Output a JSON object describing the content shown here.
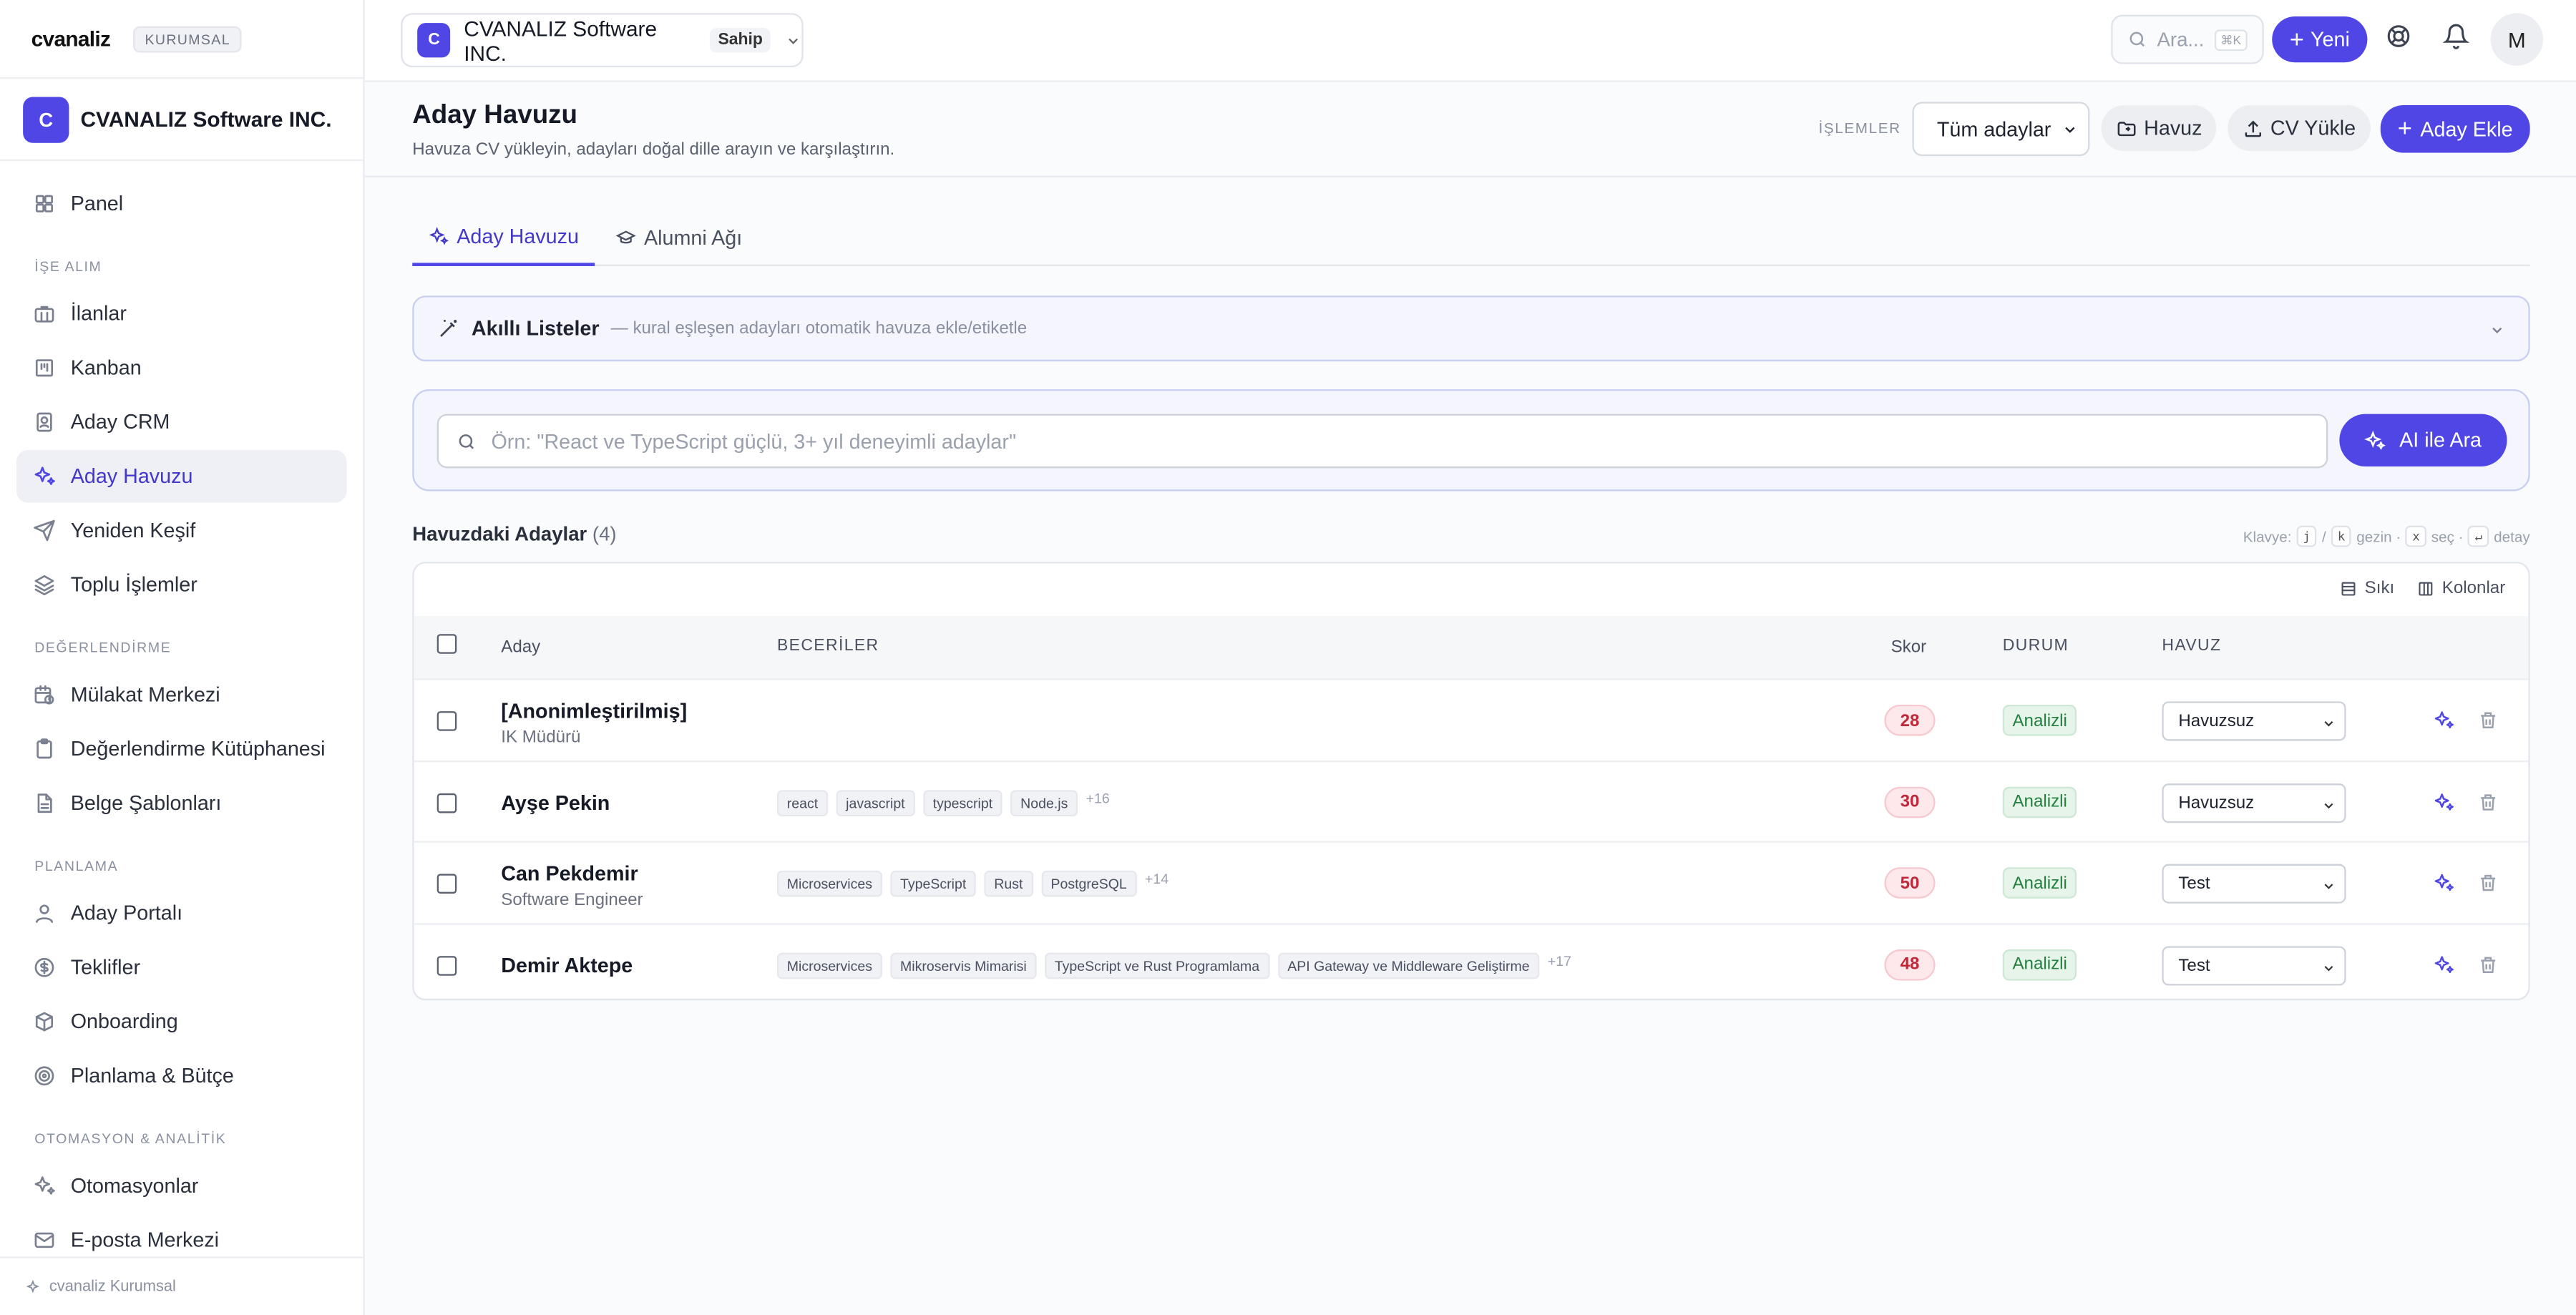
{
  "brand": {
    "logo": "cvanaliz",
    "badge": "KURUMSAL"
  },
  "org": {
    "initial": "C",
    "name": "CVANALIZ Software INC.",
    "role": "Sahip"
  },
  "sidebar": {
    "top": [
      {
        "label": "Panel",
        "icon": "grid-icon"
      }
    ],
    "sections": [
      {
        "title": "İŞE ALIM",
        "items": [
          {
            "label": "İlanlar",
            "icon": "briefcase-icon"
          },
          {
            "label": "Kanban",
            "icon": "kanban-icon"
          },
          {
            "label": "Aday CRM",
            "icon": "contact-card-icon"
          },
          {
            "label": "Aday Havuzu",
            "icon": "sparkles-icon",
            "active": true
          },
          {
            "label": "Yeniden Keşif",
            "icon": "send-icon"
          },
          {
            "label": "Toplu İşlemler",
            "icon": "layers-icon"
          }
        ]
      },
      {
        "title": "DEĞERLENDİRME",
        "items": [
          {
            "label": "Mülakat Merkezi",
            "icon": "calendar-clock-icon"
          },
          {
            "label": "Değerlendirme Kütüphanesi",
            "icon": "clipboard-icon"
          },
          {
            "label": "Belge Şablonları",
            "icon": "document-icon"
          }
        ]
      },
      {
        "title": "PLANLAMA",
        "items": [
          {
            "label": "Aday Portalı",
            "icon": "user-icon"
          },
          {
            "label": "Teklifler",
            "icon": "dollar-circle-icon"
          },
          {
            "label": "Onboarding",
            "icon": "package-icon"
          },
          {
            "label": "Planlama & Bütçe",
            "icon": "target-icon"
          }
        ]
      },
      {
        "title": "OTOMASYON & ANALİTİK",
        "items": [
          {
            "label": "Otomasyonlar",
            "icon": "sparkles-icon"
          },
          {
            "label": "E-posta Merkezi",
            "icon": "mail-icon"
          }
        ]
      }
    ],
    "footer": "cvanaliz Kurumsal"
  },
  "topbar": {
    "search_placeholder": "Ara...",
    "search_kbd": "⌘K",
    "new_label": "Yeni",
    "avatar": "M"
  },
  "header": {
    "title": "Aday Havuzu",
    "subtitle": "Havuza CV yükleyin, adayları doğal dille arayın ve karşılaştırın.",
    "ops_label": "İŞLEMLER",
    "filter_value": "Tüm adaylar",
    "pool_button": "Havuz",
    "upload_button": "CV Yükle",
    "add_button": "Aday Ekle"
  },
  "tabs": [
    {
      "label": "Aday Havuzu",
      "active": true
    },
    {
      "label": "Alumni Ağı"
    }
  ],
  "smart_lists": {
    "title": "Akıllı Listeler",
    "desc": "— kural eşleşen adayları otomatik havuza ekle/etiketle"
  },
  "ai_search": {
    "placeholder": "Örn: \"React ve TypeScript güçlü, 3+ yıl deneyimli adaylar\"",
    "button": "AI ile Ara"
  },
  "list": {
    "title": "Havuzdaki Adaylar",
    "count": "(4)",
    "kb_hint": {
      "prefix": "Klavye:",
      "k1": "j",
      "sep": "/",
      "k2": "k",
      "nav": "gezin ·",
      "k3": "x",
      "select": "seç ·",
      "k4": "↵",
      "detail": "detay"
    },
    "tools": {
      "compact": "Sıkı",
      "columns": "Kolonlar"
    },
    "columns": {
      "candidate": "Aday",
      "skills": "BECERİLER",
      "score": "Skor",
      "status": "DURUM",
      "pool": "HAVUZ"
    },
    "rows": [
      {
        "name": "[Anonimleştirilmiş]",
        "title": "IK Müdürü",
        "skills": [],
        "more": "",
        "score": "28",
        "status": "Analizli",
        "pool": "Havuzsuz"
      },
      {
        "name": "Ayşe Pekin",
        "title": "",
        "skills": [
          "react",
          "javascript",
          "typescript",
          "Node.js"
        ],
        "more": "+16",
        "score": "30",
        "status": "Analizli",
        "pool": "Havuzsuz"
      },
      {
        "name": "Can Pekdemir",
        "title": "Software Engineer",
        "skills": [
          "Microservices",
          "TypeScript",
          "Rust",
          "PostgreSQL"
        ],
        "more": "+14",
        "score": "50",
        "status": "Analizli",
        "pool": "Test"
      },
      {
        "name": "Demir Aktepe",
        "title": "",
        "skills": [
          "Microservices",
          "Mikroservis Mimarisi",
          "TypeScript ve Rust Programlama",
          "API Gateway ve Middleware Geliştirme"
        ],
        "more": "+17",
        "score": "48",
        "status": "Analizli",
        "pool": "Test"
      }
    ]
  },
  "colors": {
    "accent": "#4f46e5",
    "score_bg": "#fde8eb",
    "status_bg": "#e6f4ea"
  }
}
